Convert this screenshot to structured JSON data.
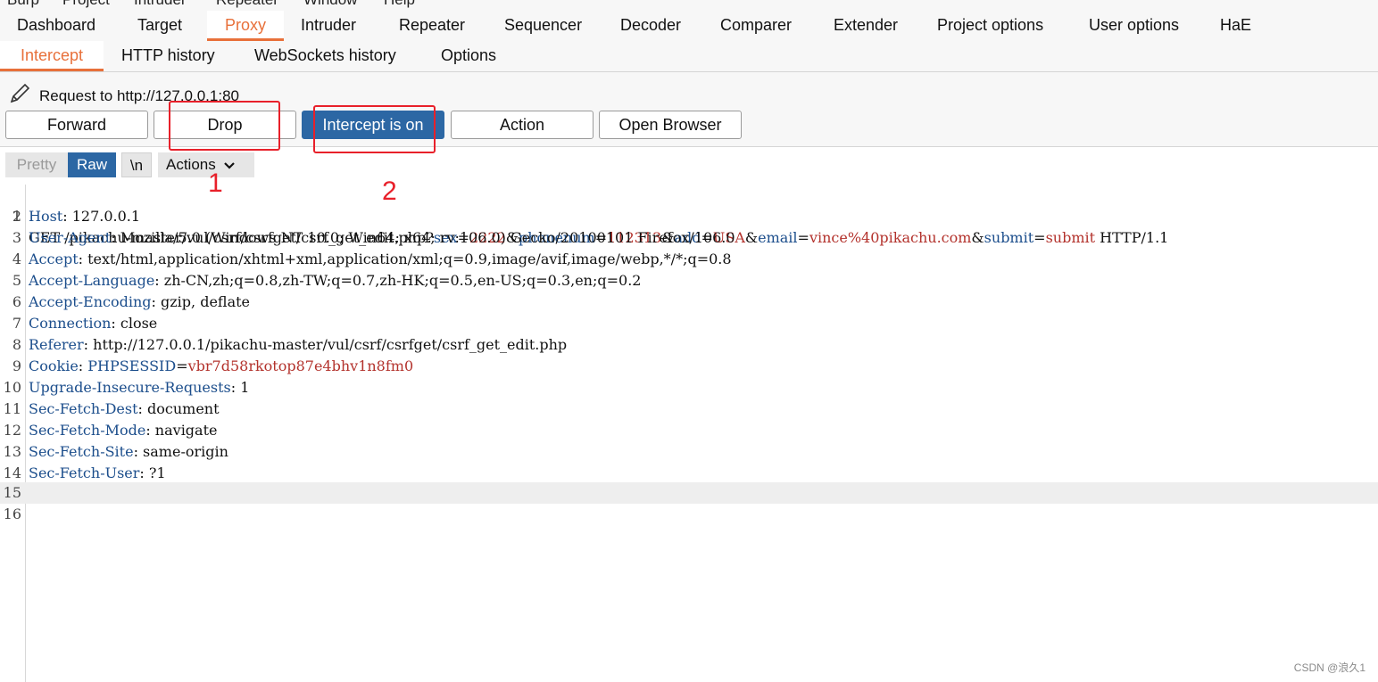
{
  "menu_bar": [
    "Burp",
    "Project",
    "Intruder",
    "Repeater",
    "Window",
    "Help"
  ],
  "main_tabs": [
    "Dashboard",
    "Target",
    "Proxy",
    "Intruder",
    "Repeater",
    "Sequencer",
    "Decoder",
    "Comparer",
    "Extender",
    "Project options",
    "User options",
    "HaE"
  ],
  "active_main_tab": "Proxy",
  "sub_tabs": [
    "Intercept",
    "HTTP history",
    "WebSockets history",
    "Options"
  ],
  "active_sub_tab": "Intercept",
  "request_label": "Request to http://127.0.0.1:80",
  "buttons": {
    "forward": "Forward",
    "drop": "Drop",
    "intercept": "Intercept is on",
    "action": "Action",
    "open_browser": "Open Browser"
  },
  "editor_modes": {
    "pretty": "Pretty",
    "raw": "Raw",
    "newline": "\\n",
    "actions": "Actions"
  },
  "request_line": {
    "prefix": "GET /pikachu-master/vul/csrf/csrfget/csrf_get_edit.php?",
    "params": [
      {
        "name": "sex",
        "value": "2222"
      },
      {
        "name": "phonenum",
        "value": "112313"
      },
      {
        "name": "add",
        "value": "USA"
      },
      {
        "name": "email",
        "value": "vince%40pikachu.com"
      },
      {
        "name": "submit",
        "value": "submit"
      }
    ],
    "suffix": " HTTP/1.1"
  },
  "headers": [
    {
      "name": "Host",
      "value": " 127.0.0.1"
    },
    {
      "name": "User-Agent",
      "value": " Mozilla/5.0 (Windows NT 10.0; Win64; x64; rv:106.0) Gecko/20100101 Firefox/106.0"
    },
    {
      "name": "Accept",
      "value": " text/html,application/xhtml+xml,application/xml;q=0.9,image/avif,image/webp,*/*;q=0.8"
    },
    {
      "name": "Accept-Language",
      "value": " zh-CN,zh;q=0.8,zh-TW;q=0.7,zh-HK;q=0.5,en-US;q=0.3,en;q=0.2"
    },
    {
      "name": "Accept-Encoding",
      "value": " gzip, deflate"
    },
    {
      "name": "Connection",
      "value": " close"
    },
    {
      "name": "Referer",
      "value": " http://127.0.0.1/pikachu-master/vul/csrf/csrfget/csrf_get_edit.php"
    },
    {
      "name": "Cookie",
      "value": "",
      "cookie_name": "PHPSESSID",
      "cookie_value": "vbr7d58rkotop87e4bhv1n8fm0"
    },
    {
      "name": "Upgrade-Insecure-Requests",
      "value": " 1"
    },
    {
      "name": "Sec-Fetch-Dest",
      "value": " document"
    },
    {
      "name": "Sec-Fetch-Mode",
      "value": " navigate"
    },
    {
      "name": "Sec-Fetch-Site",
      "value": " same-origin"
    },
    {
      "name": "Sec-Fetch-User",
      "value": " ?1"
    }
  ],
  "line_numbers": [
    "1",
    "2",
    "3",
    "4",
    "5",
    "6",
    "7",
    "8",
    "9",
    "10",
    "11",
    "12",
    "13",
    "14",
    "15",
    "16"
  ],
  "annotations": {
    "one": "1",
    "two": "2"
  },
  "watermark": "CSDN @浪久1",
  "colors": {
    "accent": "#e8703a",
    "intercept_on": "#2c67a4",
    "header_name": "#1c4e8c",
    "param_value": "#b3322c",
    "annotation": "#e8202a"
  }
}
